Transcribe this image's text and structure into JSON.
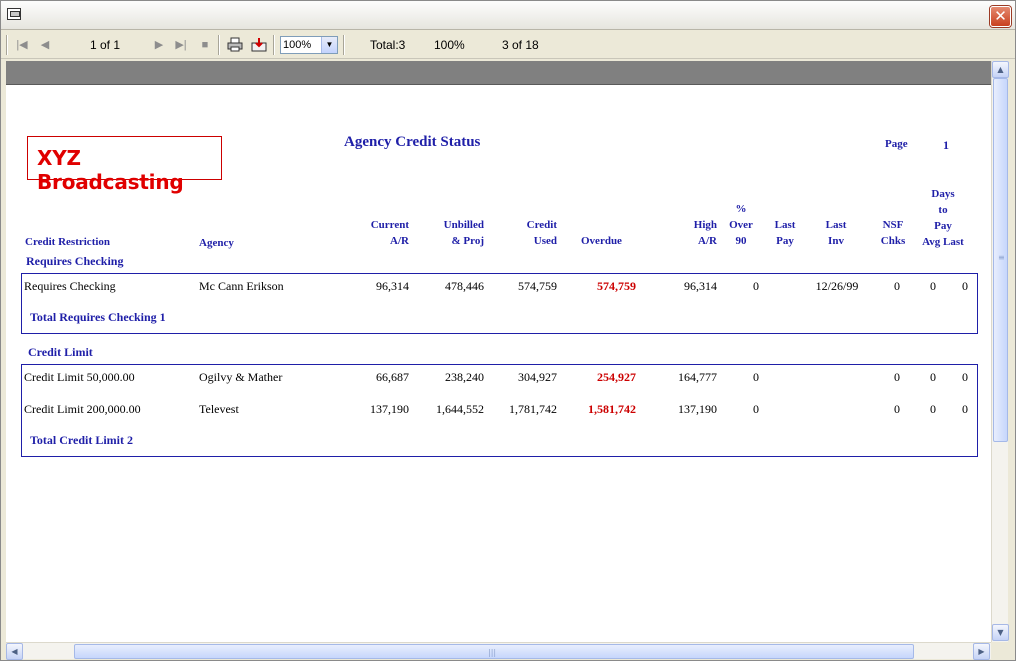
{
  "toolbar": {
    "page_indicator": "1 of 1",
    "zoom": "100%",
    "total": "Total:3",
    "percent": "100%",
    "records": "3 of 18"
  },
  "report": {
    "company": "XYZ Broadcasting",
    "title": "Agency Credit Status",
    "page_label": "Page",
    "page_number": "1",
    "headers": {
      "credit_restriction": "Credit Restriction",
      "agency": "Agency",
      "current_ar": [
        "Current",
        "A/R"
      ],
      "unbilled": [
        "Unbilled",
        "& Proj"
      ],
      "credit_used": [
        "Credit",
        "Used"
      ],
      "overdue": "Overdue",
      "high_ar": [
        "High",
        "A/R"
      ],
      "pct_over_90": [
        "%",
        "Over",
        "90"
      ],
      "last_pay": [
        "Last",
        "Pay"
      ],
      "last_inv": [
        "Last",
        "Inv"
      ],
      "nsf": [
        "NSF",
        "Chks"
      ],
      "days_to_pay": [
        "Days",
        "to",
        "Pay",
        "Avg",
        "Last"
      ]
    },
    "groups": [
      {
        "title": "Requires Checking",
        "total": "Total Requires Checking 1",
        "rows": [
          {
            "restriction": "Requires Checking",
            "agency": "Mc Cann Erikson",
            "current_ar": "96,314",
            "unbilled": "478,446",
            "credit_used": "574,759",
            "overdue": "574,759",
            "high_ar": "96,314",
            "pct_over_90": "0",
            "last_pay": "",
            "last_inv": "12/26/99",
            "nsf": "0",
            "avg": "0",
            "last": "0"
          }
        ]
      },
      {
        "title": "Credit Limit",
        "total": "Total Credit Limit 2",
        "rows": [
          {
            "restriction": "Credit Limit 50,000.00",
            "agency": "Ogilvy & Mather",
            "current_ar": "66,687",
            "unbilled": "238,240",
            "credit_used": "304,927",
            "overdue": "254,927",
            "high_ar": "164,777",
            "pct_over_90": "0",
            "last_pay": "",
            "last_inv": "",
            "nsf": "0",
            "avg": "0",
            "last": "0"
          },
          {
            "restriction": "Credit Limit 200,000.00",
            "agency": "Televest",
            "current_ar": "137,190",
            "unbilled": "1,644,552",
            "credit_used": "1,781,742",
            "overdue": "1,581,742",
            "high_ar": "137,190",
            "pct_over_90": "0",
            "last_pay": "",
            "last_inv": "",
            "nsf": "0",
            "avg": "0",
            "last": "0"
          }
        ]
      }
    ]
  },
  "colors": {
    "header_blue": "#1f1fa8",
    "overdue_red": "#cc0000",
    "logo_red": "#e00000"
  },
  "icons": [
    "app-icon",
    "close-icon",
    "first-page-icon",
    "previous-page-icon",
    "next-page-icon",
    "last-page-icon",
    "stop-icon",
    "print-icon",
    "export-icon",
    "dropdown-arrow-icon",
    "scroll-up-icon",
    "scroll-down-icon",
    "scroll-left-icon",
    "scroll-right-icon"
  ]
}
